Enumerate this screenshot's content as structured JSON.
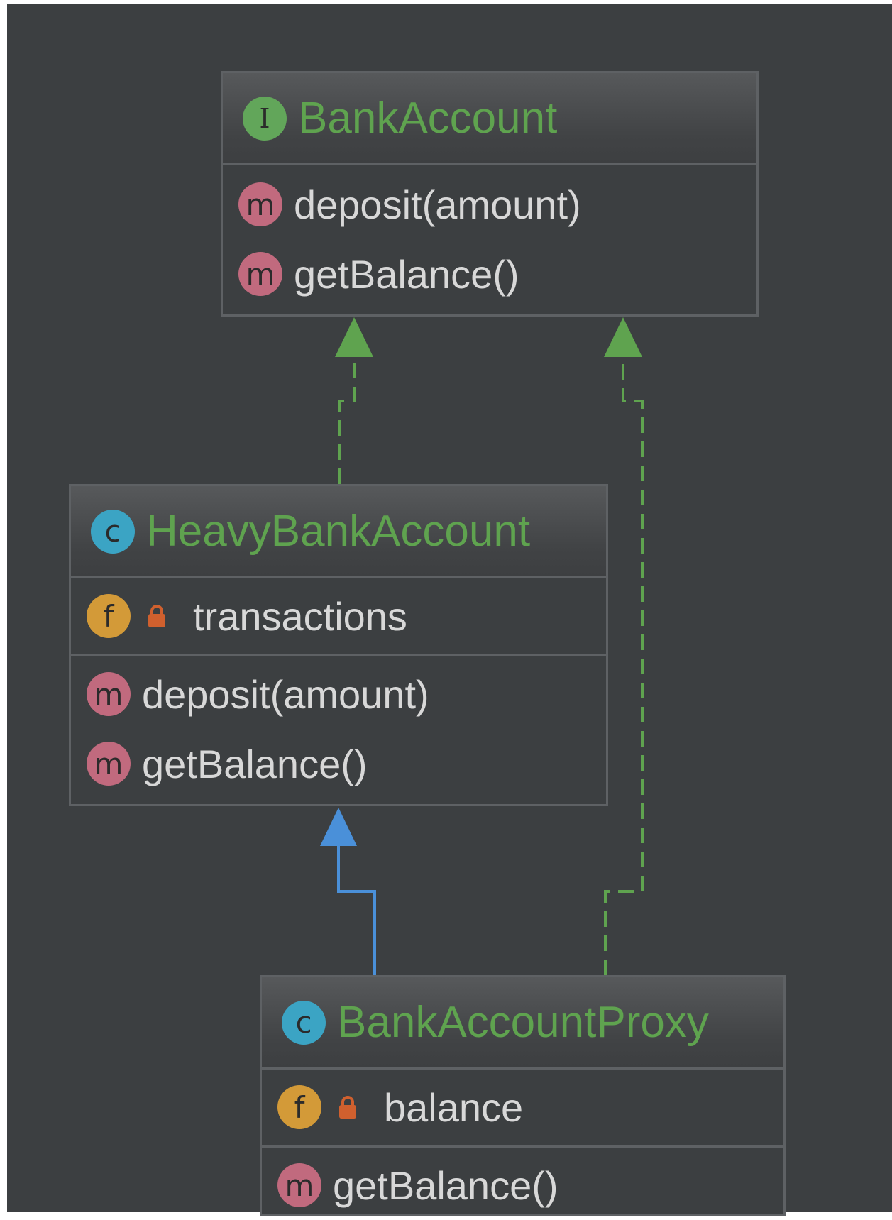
{
  "colors": {
    "background": "#3c3f41",
    "border": "#5e6164",
    "title": "#5fa34f",
    "member_text": "#d8d8d8",
    "interface_badge": "#62a65a",
    "class_badge": "#3ba4c4",
    "method_badge": "#c16a7e",
    "field_badge": "#d39a38",
    "private_lock": "#d0602e",
    "realization_edge": "#5fa34f",
    "generalization_edge": "#4a90d9"
  },
  "classes": {
    "bank_account": {
      "badge_letter": "I",
      "badge_icon": "interface-icon",
      "name": "BankAccount",
      "methods": [
        "deposit(amount)",
        "getBalance()"
      ]
    },
    "heavy_bank_account": {
      "badge_letter": "c",
      "badge_icon": "class-icon",
      "name": "HeavyBankAccount",
      "fields": [
        "transactions"
      ],
      "methods": [
        "deposit(amount)",
        "getBalance()"
      ]
    },
    "bank_account_proxy": {
      "badge_letter": "c",
      "badge_icon": "class-icon",
      "name": "BankAccountProxy",
      "fields": [
        "balance"
      ],
      "methods": [
        "getBalance()"
      ]
    }
  },
  "member_badges": {
    "method": "m",
    "field": "f"
  },
  "relations": [
    {
      "from": "HeavyBankAccount",
      "to": "BankAccount",
      "kind": "realization"
    },
    {
      "from": "BankAccountProxy",
      "to": "BankAccount",
      "kind": "realization"
    },
    {
      "from": "BankAccountProxy",
      "to": "HeavyBankAccount",
      "kind": "generalization"
    }
  ]
}
